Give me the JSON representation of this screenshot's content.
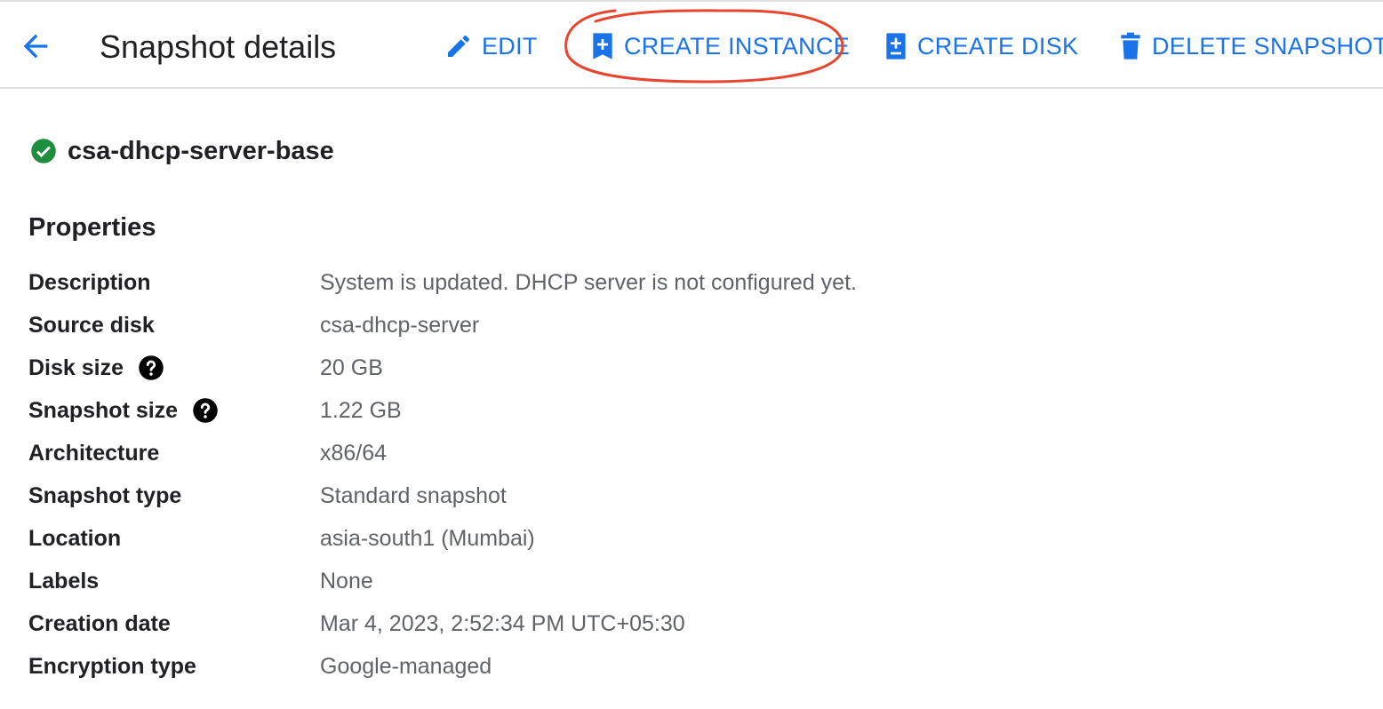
{
  "header": {
    "title": "Snapshot details",
    "back_icon": "arrow-back-icon",
    "actions": {
      "edit": "EDIT",
      "create_instance": "CREATE INSTANCE",
      "create_disk": "CREATE DISK",
      "delete_snapshot": "DELETE SNAPSHOT"
    }
  },
  "colors": {
    "accent": "#1a73e8",
    "status_ok": "#1e8e3e",
    "annotation": "#e8452f"
  },
  "resource": {
    "name": "csa-dhcp-server-base",
    "status_icon": "check-circle-icon"
  },
  "properties": {
    "title": "Properties",
    "rows": [
      {
        "label": "Description",
        "value": "System is updated. DHCP server is not configured yet."
      },
      {
        "label": "Source disk",
        "value": "csa-dhcp-server"
      },
      {
        "label": "Disk size",
        "value": "20 GB",
        "help": true
      },
      {
        "label": "Snapshot size",
        "value": "1.22 GB",
        "help": true
      },
      {
        "label": "Architecture",
        "value": "x86/64"
      },
      {
        "label": "Snapshot type",
        "value": "Standard snapshot"
      },
      {
        "label": "Location",
        "value": "asia-south1 (Mumbai)"
      },
      {
        "label": "Labels",
        "value": "None"
      },
      {
        "label": "Creation date",
        "value": "Mar 4, 2023, 2:52:34 PM UTC+05:30"
      },
      {
        "label": "Encryption type",
        "value": "Google-managed"
      }
    ]
  }
}
